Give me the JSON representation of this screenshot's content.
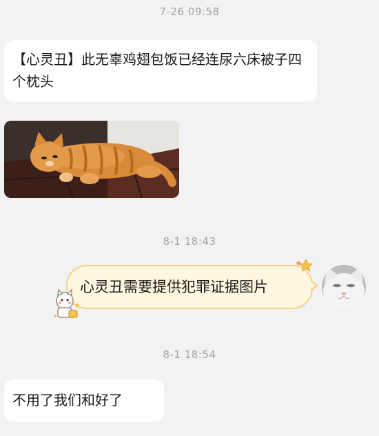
{
  "chat": {
    "messages": [
      {
        "type": "timestamp",
        "text": "7-26 09:58"
      },
      {
        "type": "text",
        "side": "left",
        "text": "【心灵丑】此无辜鸡翅包饭已经连尿六床被子四个枕头"
      },
      {
        "type": "image",
        "side": "left",
        "image_semantic": "orange-tabby-cat-lying-on-floor"
      },
      {
        "type": "timestamp",
        "text": "8-1 18:43"
      },
      {
        "type": "text",
        "side": "right",
        "text": "心灵丑需要提供犯罪证据图片",
        "bubble_style": "cream-sticker-bubble"
      },
      {
        "type": "timestamp",
        "text": "8-1 18:54"
      },
      {
        "type": "text",
        "side": "left",
        "text": "不用了我们和好了"
      }
    ]
  },
  "avatar": {
    "image_semantic": "white-cat-face-avatar"
  },
  "decorations": {
    "bubble_top_right": "sparkle-stars-icon",
    "bubble_bottom_left": "cartoon-cat-sticker-icon"
  },
  "colors": {
    "background": "#f2f2f2",
    "left_bubble": "#ffffff",
    "right_bubble_fill": "#fff7df",
    "right_bubble_border": "#f3d38b",
    "timestamp_text": "#a3a3a3"
  }
}
